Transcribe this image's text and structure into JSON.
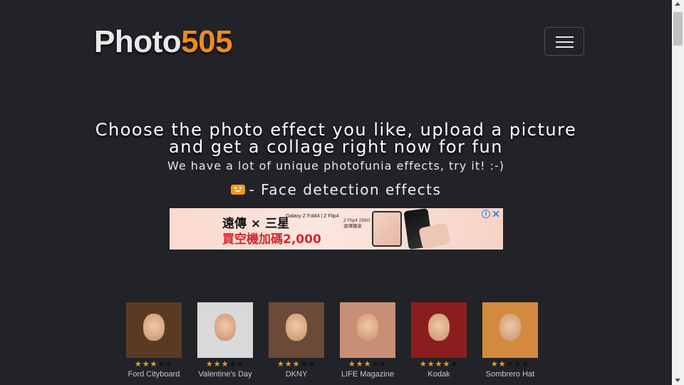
{
  "header": {
    "logo_part1": "Photo",
    "logo_part2": "505",
    "menu_button": "toggle-navigation"
  },
  "hero": {
    "line1": "Choose the photo effect you like, upload a picture",
    "line2": "and get a collage right now for fun",
    "subtitle": "We have a lot of unique photofunia effects, try it! :-)",
    "face_detection": "- Face detection effects"
  },
  "ad": {
    "line1": "遠傳 × 三星",
    "line1_small": "Galaxy Z Fold4 | Z Flip4",
    "line2": "買空機加碼2,000",
    "spec": "Z Flip4 256G 遠傳獨家",
    "info_icon": "i",
    "close_icon": "✕"
  },
  "effects": [
    {
      "name": "Ford Cityboard",
      "rating": 2.5,
      "bg": "#5a3b22"
    },
    {
      "name": "Valentine's Day",
      "rating": 3,
      "bg": "#d9d9d9"
    },
    {
      "name": "DKNY",
      "rating": 3,
      "bg": "#6b4a3a"
    },
    {
      "name": "LIFE Magazine",
      "rating": 3,
      "bg": "#c98f76"
    },
    {
      "name": "Kodak",
      "rating": 4,
      "bg": "#8a1e1e"
    },
    {
      "name": "Sombrero Hat",
      "rating": 2,
      "bg": "#d48a3e"
    }
  ],
  "colors": {
    "background": "#212328",
    "accent": "#f08a1c",
    "star": "#f0a020"
  }
}
